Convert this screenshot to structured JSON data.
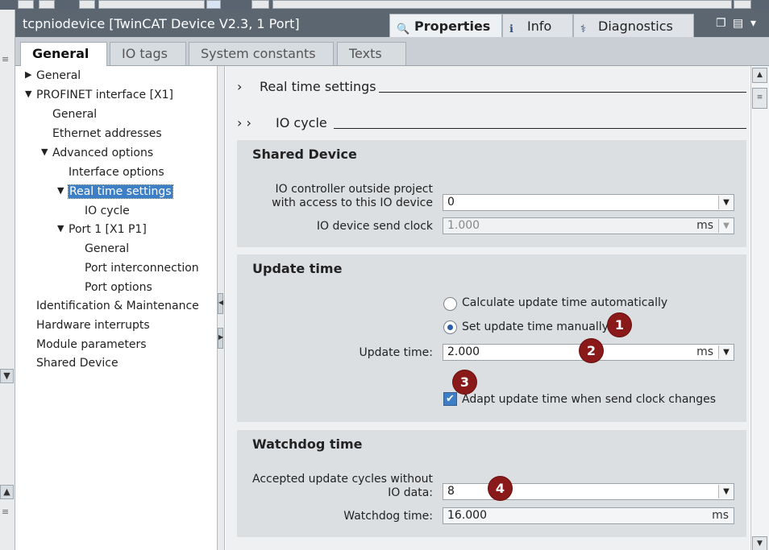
{
  "window": {
    "title": "tcpniodevice [TwinCAT Device V2.3, 1 Port]",
    "panel_tabs": [
      {
        "label": "Properties",
        "icon": "properties-icon"
      },
      {
        "label": "Info",
        "icon": "info-icon"
      },
      {
        "label": "Diagnostics",
        "icon": "diagnostics-icon"
      }
    ],
    "controls": {
      "restore": "❐",
      "menu": "▤",
      "dropdown": "▾"
    }
  },
  "main_tabs": [
    {
      "label": "General",
      "active": true
    },
    {
      "label": "IO tags"
    },
    {
      "label": "System constants"
    },
    {
      "label": "Texts"
    }
  ],
  "tree": [
    {
      "label": "General",
      "arrow": "▶"
    },
    {
      "label": "PROFINET interface [X1]",
      "arrow": "▼"
    },
    {
      "label": "General"
    },
    {
      "label": "Ethernet addresses"
    },
    {
      "label": "Advanced options",
      "arrow": "▼"
    },
    {
      "label": "Interface options"
    },
    {
      "label": "Real time settings",
      "arrow": "▼",
      "selected": true
    },
    {
      "label": "IO cycle"
    },
    {
      "label": "Port 1 [X1 P1]",
      "arrow": "▼"
    },
    {
      "label": "General"
    },
    {
      "label": "Port interconnection"
    },
    {
      "label": "Port options"
    },
    {
      "label": "Identification & Maintenance"
    },
    {
      "label": "Hardware interrupts"
    },
    {
      "label": "Module parameters"
    },
    {
      "label": "Shared Device"
    }
  ],
  "content": {
    "header_arrow_1": "›",
    "header_arrow_2": "› ›",
    "real_time_settings": "Real time settings",
    "io_cycle": "IO cycle",
    "shared_device": {
      "title": "Shared Device",
      "io_controller_label_1": "IO controller outside project",
      "io_controller_label_2": "with access to this IO device",
      "io_controller_value": "0",
      "send_clock_label": "IO device send clock",
      "send_clock_value": "1.000",
      "send_clock_unit": "ms"
    },
    "update_time": {
      "title": "Update time",
      "option_auto": "Calculate update time automatically",
      "option_manual": "Set update time manually",
      "update_time_label": "Update time:",
      "update_time_value": "2.000",
      "update_time_unit": "ms",
      "adapt_label": "Adapt update time when send clock changes",
      "adapt_checked": true
    },
    "watchdog": {
      "title": "Watchdog time",
      "cycles_label_1": "Accepted update cycles without",
      "cycles_label_2": "IO data:",
      "cycles_value": "8",
      "watchdog_label": "Watchdog time:",
      "watchdog_value": "16.000",
      "watchdog_unit": "ms"
    }
  },
  "badges": [
    "1",
    "2",
    "3",
    "4"
  ],
  "glyphs": {
    "dropdown": "▼",
    "up": "▲",
    "down": "▼",
    "check": "✔",
    "grip": "≡",
    "tri_left": "◀",
    "tri_right": "▶"
  },
  "colors": {
    "titlebar": "#5b6671",
    "selection": "#3d7fc6",
    "badge": "#8a1a1a",
    "section": "#dcdfe2"
  }
}
